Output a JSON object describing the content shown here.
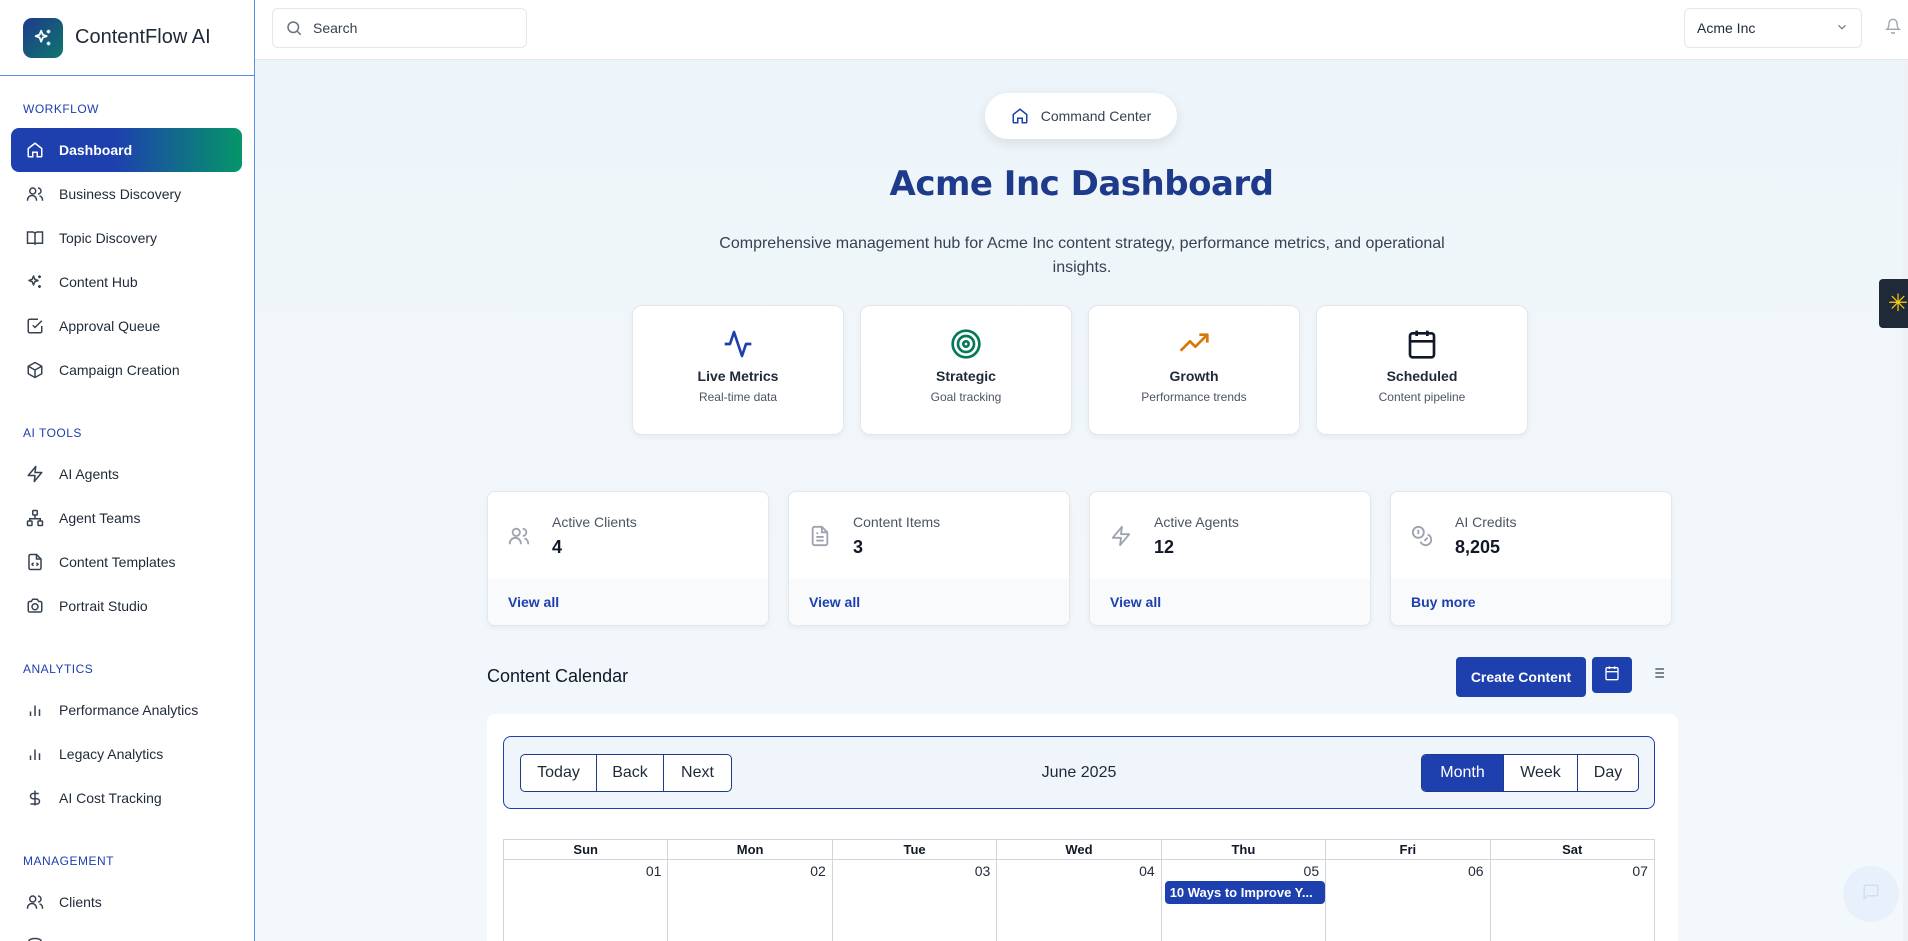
{
  "app": {
    "name": "ContentFlow AI"
  },
  "sidebar": {
    "sections": [
      {
        "title": "WORKFLOW",
        "items": [
          {
            "label": "Dashboard",
            "icon": "home-icon"
          },
          {
            "label": "Business Discovery",
            "icon": "users-icon"
          },
          {
            "label": "Topic Discovery",
            "icon": "book-open-icon"
          },
          {
            "label": "Content Hub",
            "icon": "sparkles-icon"
          },
          {
            "label": "Approval Queue",
            "icon": "check-square-icon"
          },
          {
            "label": "Campaign Creation",
            "icon": "box-icon"
          }
        ]
      },
      {
        "title": "AI TOOLS",
        "items": [
          {
            "label": "AI Agents",
            "icon": "zap-icon"
          },
          {
            "label": "Agent Teams",
            "icon": "network-icon"
          },
          {
            "label": "Content Templates",
            "icon": "file-code-icon"
          },
          {
            "label": "Portrait Studio",
            "icon": "camera-icon"
          }
        ]
      },
      {
        "title": "ANALYTICS",
        "items": [
          {
            "label": "Performance Analytics",
            "icon": "bar-chart-icon"
          },
          {
            "label": "Legacy Analytics",
            "icon": "bar-chart-icon"
          },
          {
            "label": "AI Cost Tracking",
            "icon": "dollar-icon"
          }
        ]
      },
      {
        "title": "MANAGEMENT",
        "items": [
          {
            "label": "Clients",
            "icon": "users-icon"
          }
        ]
      }
    ],
    "active": "Dashboard"
  },
  "topbar": {
    "search_placeholder": "Search",
    "org": "Acme Inc"
  },
  "hero": {
    "pill": "Command Center",
    "title": "Acme Inc Dashboard",
    "description": "Comprehensive management hub for Acme Inc content strategy, performance metrics, and operational insights."
  },
  "features": [
    {
      "title": "Live Metrics",
      "subtitle": "Real-time data",
      "icon": "activity-icon",
      "color": "#1e40af"
    },
    {
      "title": "Strategic",
      "subtitle": "Goal tracking",
      "icon": "target-icon",
      "color": "#047857"
    },
    {
      "title": "Growth",
      "subtitle": "Performance trends",
      "icon": "trending-up-icon",
      "color": "#d97706"
    },
    {
      "title": "Scheduled",
      "subtitle": "Content pipeline",
      "icon": "calendar-icon",
      "color": "#111827"
    }
  ],
  "stats": [
    {
      "label": "Active Clients",
      "value": "4",
      "link": "View all",
      "icon": "users-icon"
    },
    {
      "label": "Content Items",
      "value": "3",
      "link": "View all",
      "icon": "file-text-icon"
    },
    {
      "label": "Active Agents",
      "value": "12",
      "link": "View all",
      "icon": "zap-icon"
    },
    {
      "label": "AI Credits",
      "value": "8,205",
      "link": "Buy more",
      "icon": "coins-icon"
    }
  ],
  "calendar": {
    "title": "Content Calendar",
    "create_label": "Create Content",
    "nav_buttons": [
      "Today",
      "Back",
      "Next"
    ],
    "month_label": "June 2025",
    "view_buttons": [
      "Month",
      "Week",
      "Day"
    ],
    "active_view": "Month",
    "weekdays": [
      "Sun",
      "Mon",
      "Tue",
      "Wed",
      "Thu",
      "Fri",
      "Sat"
    ],
    "first_week_days": [
      "01",
      "02",
      "03",
      "04",
      "05",
      "06",
      "07"
    ],
    "events": [
      {
        "day": "05",
        "title": "10 Ways to Improve Y..."
      }
    ]
  },
  "colors": {
    "primary": "#1e40af",
    "accent_green": "#059669",
    "title": "#1e3a8a"
  }
}
